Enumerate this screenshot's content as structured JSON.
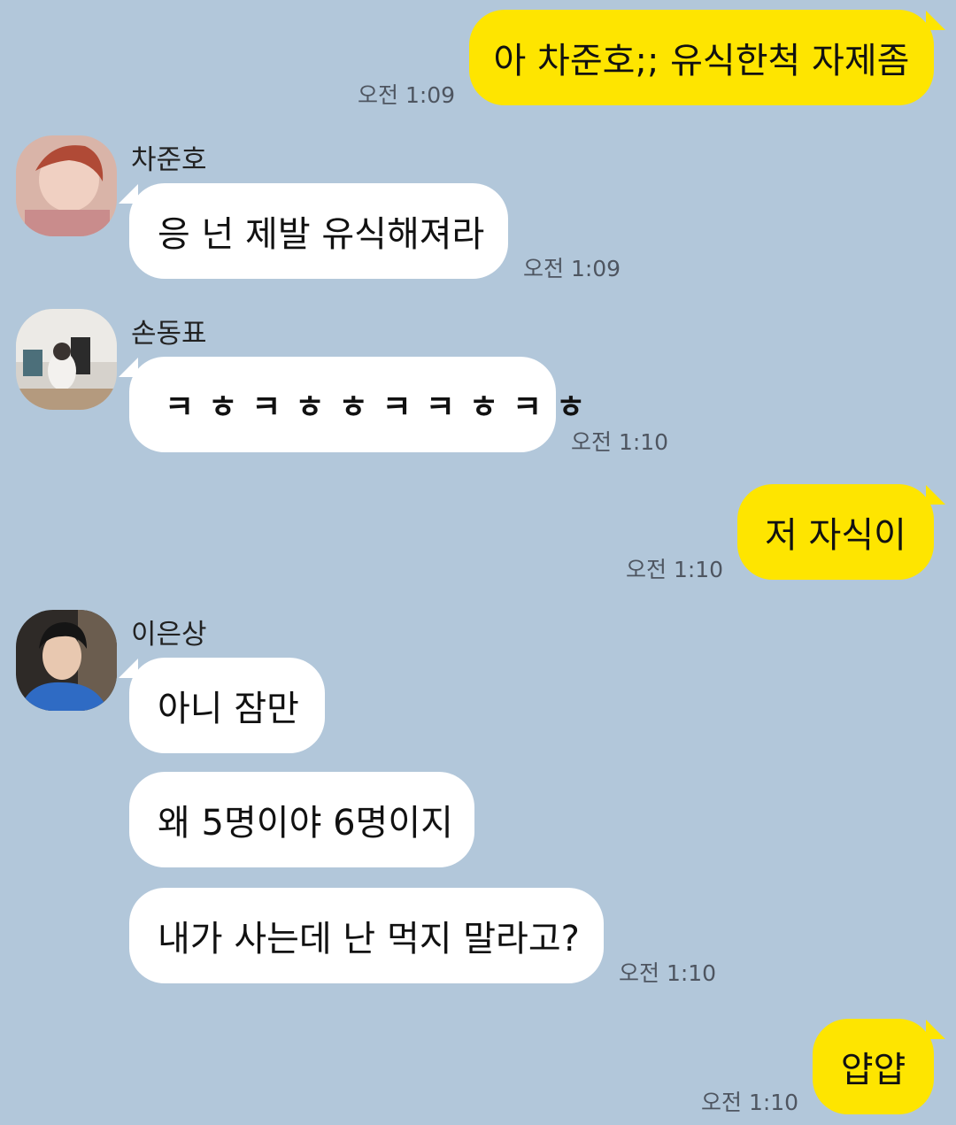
{
  "messages": [
    {
      "kind": "out",
      "text": "아 차준호;; 유식한척 자제좀",
      "time": "오전 1:09"
    },
    {
      "kind": "in",
      "sender": "차준호",
      "avatar": "avatar-photo",
      "text": "응 넌 제발 유식해져라",
      "time": "오전 1:09"
    },
    {
      "kind": "in",
      "sender": "손동표",
      "avatar": "avatar-photo",
      "text": "ㅋㅎㅋㅎㅎㅋㅋㅎㅋㅎ",
      "time": "오전 1:10"
    },
    {
      "kind": "out",
      "text": "저 자식이",
      "time": "오전 1:10"
    },
    {
      "kind": "in",
      "sender": "이은상",
      "avatar": "avatar-photo",
      "text": "아니 잠만"
    },
    {
      "kind": "in",
      "text": "왜 5명이야 6명이지"
    },
    {
      "kind": "in",
      "text": "내가 사는데 난 먹지 말라고?",
      "time": "오전 1:10"
    },
    {
      "kind": "out",
      "text": "얍얍",
      "time": "오전 1:10"
    }
  ],
  "colors": {
    "background": "#b2c7da",
    "outgoing_bubble": "#fee500",
    "incoming_bubble": "#ffffff"
  }
}
